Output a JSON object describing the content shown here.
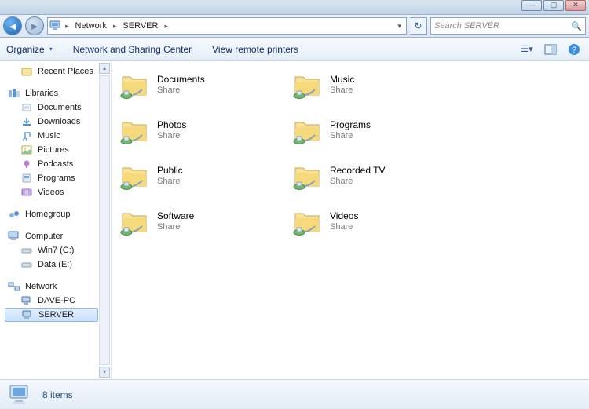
{
  "breadcrumb": {
    "root": "Network",
    "server": "SERVER"
  },
  "search": {
    "placeholder": "Search SERVER"
  },
  "toolbar": {
    "organize": "Organize",
    "net_center": "Network and Sharing Center",
    "remote_printers": "View remote printers"
  },
  "sidebar": {
    "recent": "Recent Places",
    "libraries": "Libraries",
    "lib_items": [
      "Documents",
      "Downloads",
      "Music",
      "Pictures",
      "Podcasts",
      "Programs",
      "Videos"
    ],
    "homegroup": "Homegroup",
    "computer": "Computer",
    "drives": [
      "Win7 (C:)",
      "Data (E:)"
    ],
    "network": "Network",
    "hosts": [
      "DAVE-PC",
      "SERVER"
    ]
  },
  "shares": [
    {
      "name": "Documents",
      "sub": "Share"
    },
    {
      "name": "Music",
      "sub": "Share"
    },
    {
      "name": "Photos",
      "sub": "Share"
    },
    {
      "name": "Programs",
      "sub": "Share"
    },
    {
      "name": "Public",
      "sub": "Share"
    },
    {
      "name": "Recorded TV",
      "sub": "Share"
    },
    {
      "name": "Software",
      "sub": "Share"
    },
    {
      "name": "Videos",
      "sub": "Share"
    }
  ],
  "status": {
    "count": "8 items"
  },
  "win": {
    "min": "—",
    "max": "▢",
    "close": "✕"
  }
}
